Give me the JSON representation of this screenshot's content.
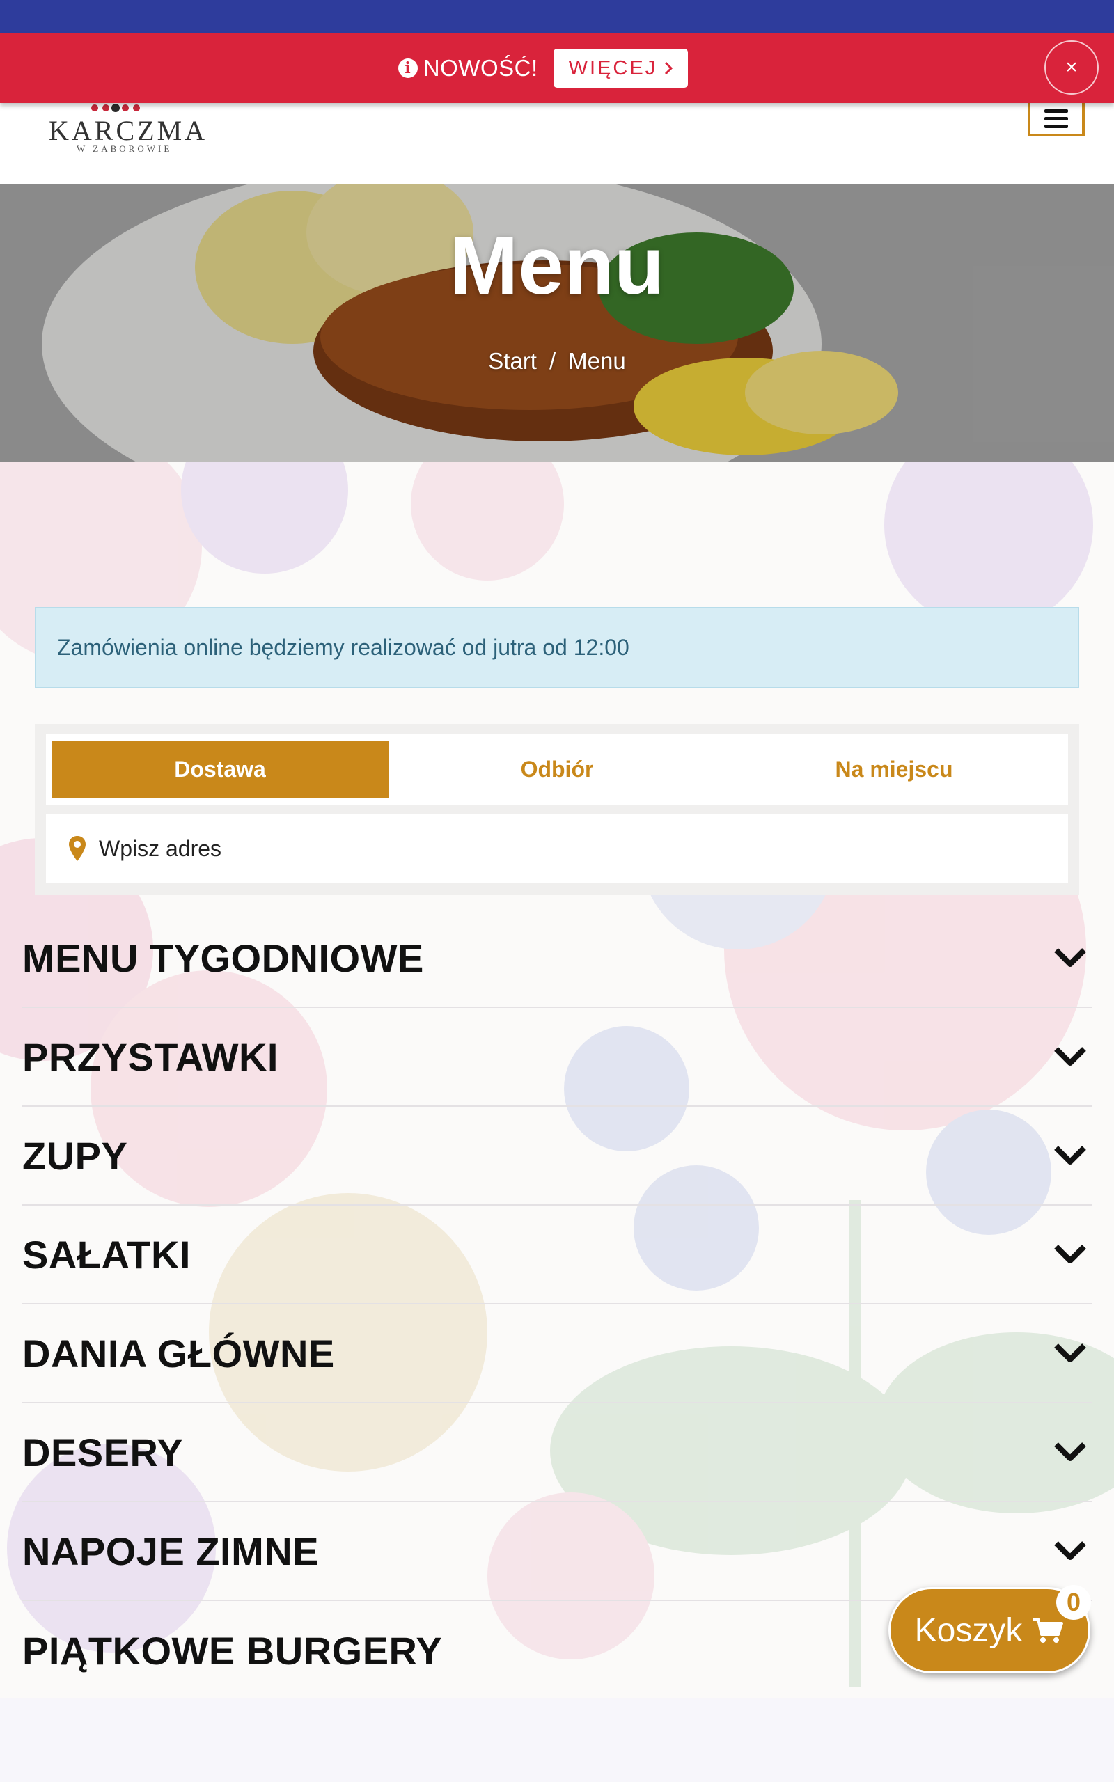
{
  "promo": {
    "label": "NOWOŚĆ!",
    "button_label": "WIĘCEJ",
    "close_label": "×",
    "color": "#d9233b"
  },
  "header": {
    "logo_name": "KARCZMA",
    "logo_sub": "W ZABOROWIE"
  },
  "hero": {
    "title": "Menu",
    "breadcrumb": [
      "Start",
      "/",
      "Menu"
    ]
  },
  "notice": "Zamówienia online będziemy realizować od jutra od 12:00",
  "order": {
    "tabs": [
      "Dostawa",
      "Odbiór",
      "Na miejscu"
    ],
    "active_tab": "Dostawa",
    "address_placeholder": "Wpisz adres"
  },
  "categories": [
    "MENU TYGODNIOWE",
    "PRZYSTAWKI",
    "ZUPY",
    "SAŁATKI",
    "DANIA GŁÓWNE",
    "DESERY",
    "NAPOJE ZIMNE",
    "PIĄTKOWE BURGERY"
  ],
  "cart": {
    "label": "Koszyk",
    "count": "0"
  },
  "colors": {
    "accent": "#c9881a",
    "status_bar": "#2e3c9c",
    "notice_bg": "#d7edf5",
    "notice_text": "#2c6179"
  },
  "icons": [
    "info-icon",
    "chevron-right-icon",
    "close-icon",
    "menu-icon",
    "map-pin-icon",
    "chevron-down-icon",
    "cart-icon"
  ]
}
